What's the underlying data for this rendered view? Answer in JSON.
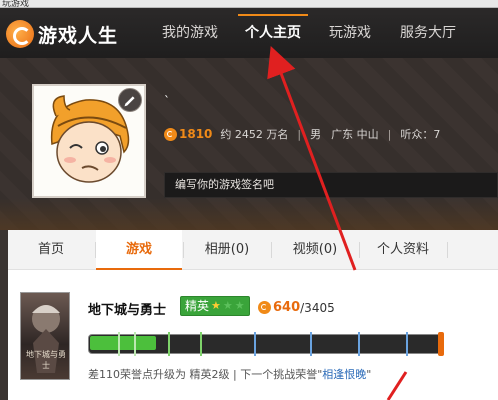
{
  "browser": {
    "tab_fragment": "玩游戏"
  },
  "header": {
    "logo_text": "游戏人生",
    "nav": [
      {
        "label": "我的游戏",
        "active": false
      },
      {
        "label": "个人主页",
        "active": true
      },
      {
        "label": "玩游戏",
        "active": false
      },
      {
        "label": "服务大厅",
        "active": false
      }
    ]
  },
  "profile": {
    "nickname": "`",
    "score": "1810",
    "rank": "约 2452 万名",
    "gender": "男",
    "location": "广东 中山",
    "followers_label": "听众：",
    "followers": "7",
    "signature_placeholder": "编写你的游戏签名吧"
  },
  "tabs": [
    {
      "label": "首页",
      "active": false
    },
    {
      "label": "游戏",
      "active": true
    },
    {
      "label": "相册(0)",
      "active": false
    },
    {
      "label": "视频(0)",
      "active": false
    },
    {
      "label": "个人资料",
      "active": false
    }
  ],
  "game": {
    "name": "地下城与勇士",
    "cover_title": "地下城与勇士",
    "rank_badge": "精英",
    "stars_total": 3,
    "stars_filled": 1,
    "honor_current": "640",
    "honor_total": "/3405",
    "progress_fraction": 0.188,
    "upgrade_text": "差110荣誉点升级为 精英2级 | 下一个挑战荣誉\"",
    "next_challenge": "相逢恨晚",
    "upgrade_suffix": "\""
  },
  "colors": {
    "accent": "#e86a0c",
    "nav_bg": "#1f1e1e",
    "rank_green": "#3aa43a",
    "annotation_red": "#e02020"
  }
}
